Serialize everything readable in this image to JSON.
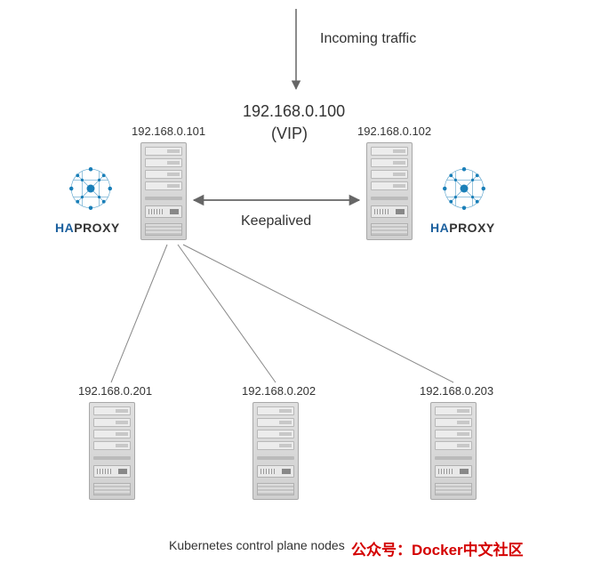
{
  "diagram": {
    "incoming_label": "Incoming traffic",
    "vip_ip": "192.168.0.100",
    "vip_suffix": "(VIP)",
    "keepalived_label": "Keepalived",
    "caption": "Kubernetes control plane nodes",
    "watermark": "公众号：Docker中文社区",
    "lb_left_ip": "192.168.0.101",
    "lb_right_ip": "192.168.0.102",
    "node1_ip": "192.168.0.201",
    "node2_ip": "192.168.0.202",
    "node3_ip": "192.168.0.203",
    "haproxy_ha": "HA",
    "haproxy_proxy": "PROXY"
  },
  "colors": {
    "line": "#666666",
    "brand_blue": "#1a7fb8"
  }
}
